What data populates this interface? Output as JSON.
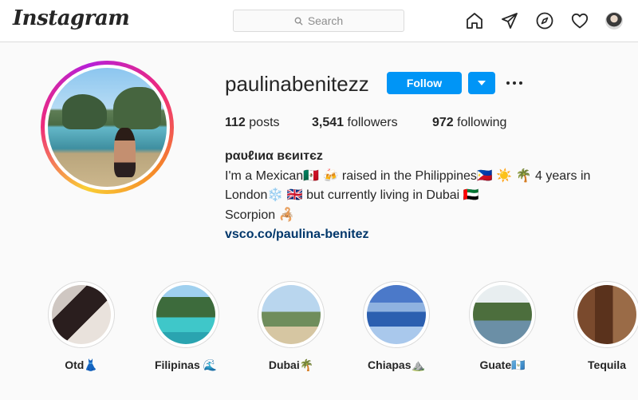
{
  "header": {
    "logo_text": "Instagram",
    "search_placeholder": "Search",
    "nav_icons": [
      "home-icon",
      "direct-icon",
      "explore-icon",
      "activity-icon",
      "profile-avatar"
    ]
  },
  "profile": {
    "username": "paulinabenitezz",
    "follow_label": "Follow",
    "stats": {
      "posts_count": "112",
      "posts_label": "posts",
      "followers_count": "3,541",
      "followers_label": "followers",
      "following_count": "972",
      "following_label": "following"
    },
    "full_name": "pαυℓιиα вєиιтєz",
    "bio_line1": "I'm a Mexican🇲🇽 🍻 raised in the Philippines🇵🇭 ☀️ 🌴 4 years in",
    "bio_line2": "London❄️ 🇬🇧 but currently living in Dubai 🇦🇪",
    "bio_line3": "Scorpion 🦂",
    "website": "vsco.co/paulina-benitez"
  },
  "highlights": [
    {
      "label": "Otd👗"
    },
    {
      "label": "Filipinas 🌊"
    },
    {
      "label": "Dubai🌴"
    },
    {
      "label": "Chiapas⛰️"
    },
    {
      "label": "Guate🇬🇹"
    },
    {
      "label": "Tequila"
    }
  ],
  "colors": {
    "accent": "#0095f6",
    "link": "#00376b",
    "border": "#dbdbdb",
    "background": "#fafafa"
  }
}
